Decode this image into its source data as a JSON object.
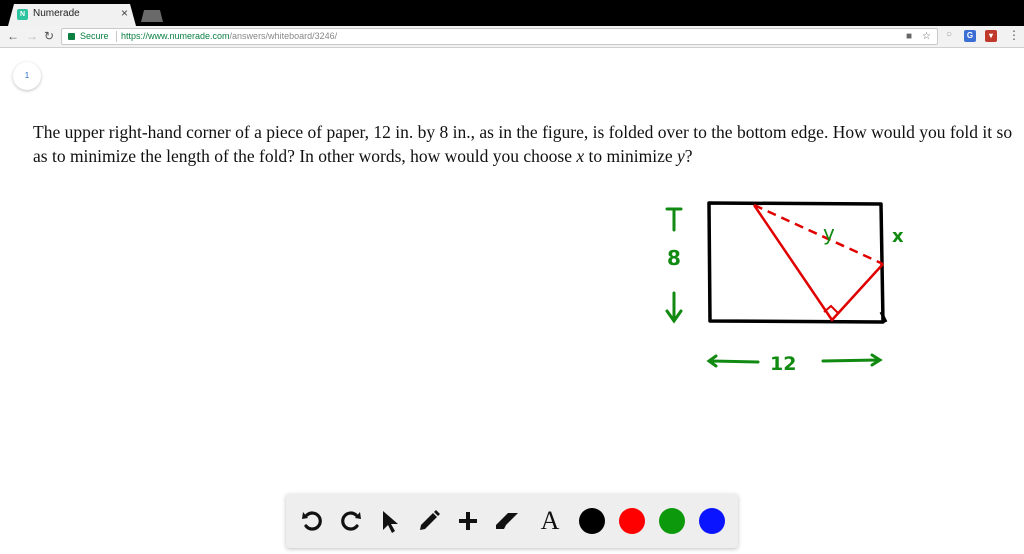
{
  "browser": {
    "tab_title": "Numerade",
    "tab_favicon_letter": "N",
    "tab_close": "×",
    "secure_label": "Secure",
    "url_host": "https://www.numerade.com",
    "url_path": "/answers/whiteboard/3246/"
  },
  "page": {
    "page_number": "1",
    "problem_text_1": "The upper right-hand corner of a piece of paper, ",
    "num_12": "12",
    "problem_text_2": " in. by ",
    "num_8": "8",
    "problem_text_3": " in., as in the figure, is folded over to the bottom edge. How would you fold it so as to minimize the length of the fold? In other words, how would you choose ",
    "var_x": "x",
    "problem_text_4": " to minimize ",
    "var_y": "y",
    "problem_text_5": "?"
  },
  "figure": {
    "height_label": "8",
    "width_label": "12",
    "fold_label": "y",
    "x_label": "x",
    "colors": {
      "paper": "#000000",
      "fold": "#e00000",
      "annotation": "#118a11"
    }
  },
  "palette": {
    "tools": [
      "undo-icon",
      "redo-icon",
      "pointer-icon",
      "pencil-icon",
      "add-icon",
      "eraser-icon",
      "text-icon"
    ],
    "text_tool_label": "A",
    "colors": [
      "#000000",
      "#ff0000",
      "#0c9a0c",
      "#0a14ff"
    ]
  }
}
